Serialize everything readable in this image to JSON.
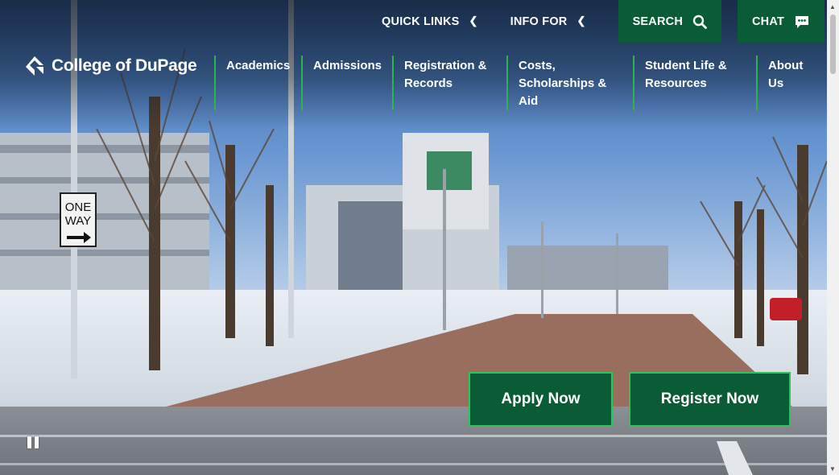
{
  "utility_nav": {
    "quick_links": "QUICK LINKS",
    "info_for": "INFO FOR",
    "search": "SEARCH",
    "chat": "CHAT"
  },
  "brand": {
    "name": "College of DuPage"
  },
  "main_nav": [
    {
      "label": "Academics"
    },
    {
      "label": "Admissions"
    },
    {
      "label": "Registration & Records"
    },
    {
      "label": "Costs, Scholarships & Aid"
    },
    {
      "label": "Student Life & Resources"
    },
    {
      "label": "About Us"
    }
  ],
  "hero": {
    "sign_line1": "ONE",
    "sign_line2": "WAY",
    "apply_label": "Apply Now",
    "register_label": "Register Now"
  },
  "colors": {
    "brand_green": "#0a5c36",
    "accent_green": "#2bb54a"
  },
  "icons": {
    "search": "search-icon",
    "chat": "chat-bubble-icon",
    "chevron": "chevron-left-icon",
    "pause": "pause-icon"
  }
}
